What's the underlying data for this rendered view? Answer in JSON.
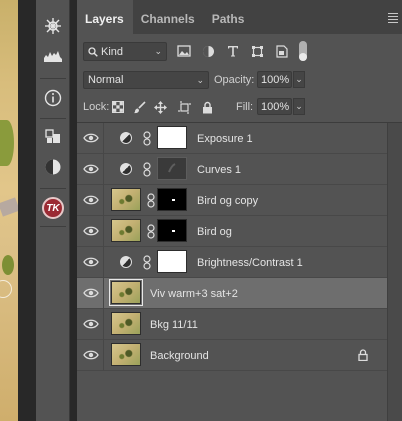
{
  "panel": {
    "tabs": [
      {
        "label": "Layers",
        "active": true
      },
      {
        "label": "Channels",
        "active": false
      },
      {
        "label": "Paths",
        "active": false
      }
    ]
  },
  "filter": {
    "kind_label": "Kind",
    "icons": [
      "image-filter-icon",
      "adjustment-filter-icon",
      "type-filter-icon",
      "shape-filter-icon",
      "smart-object-filter-icon"
    ]
  },
  "blend": {
    "mode": "Normal",
    "opacity_label": "Opacity:",
    "opacity_value": "100%"
  },
  "lock": {
    "label": "Lock:",
    "fill_label": "Fill:",
    "fill_value": "100%"
  },
  "layers": [
    {
      "name": "Exposure 1",
      "type": "adjustment",
      "thumb": "white",
      "selected": false
    },
    {
      "name": "Curves 1",
      "type": "adjustment",
      "thumb": "curves",
      "selected": false
    },
    {
      "name": "Bird og copy",
      "type": "masked",
      "thumb": "photo",
      "mask": "black",
      "selected": false
    },
    {
      "name": "Bird og",
      "type": "masked",
      "thumb": "photo",
      "mask": "black",
      "selected": false
    },
    {
      "name": "Brightness/Contrast 1",
      "type": "adjustment",
      "thumb": "white",
      "selected": false
    },
    {
      "name": "Viv warm+3 sat+2",
      "type": "pixel",
      "thumb": "photo",
      "selected": true
    },
    {
      "name": "Bkg 11/11",
      "type": "pixel",
      "thumb": "photo",
      "selected": false
    },
    {
      "name": "Background",
      "type": "pixel",
      "thumb": "photo",
      "selected": false,
      "locked": true
    }
  ],
  "tools": {
    "tk_label": "TK"
  }
}
